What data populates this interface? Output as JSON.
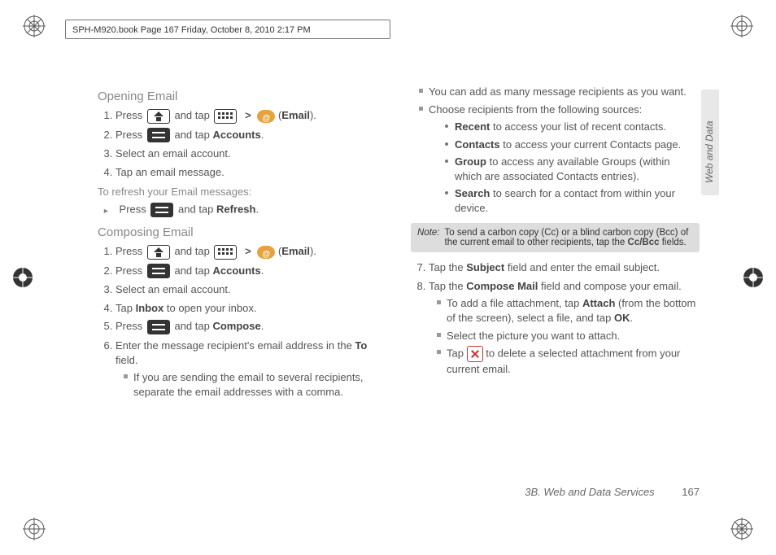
{
  "header": {
    "text": "SPH-M920.book  Page 167  Friday, October 8, 2010  2:17 PM"
  },
  "side_tab": {
    "label": "Web and Data"
  },
  "footer": {
    "section": "3B. Web and Data Services",
    "page": "167"
  },
  "labels": {
    "email": "Email",
    "accounts": "Accounts",
    "refresh": "Refresh",
    "inbox": "Inbox",
    "compose": "Compose",
    "to": "To",
    "recent": "Recent",
    "contacts": "Contacts",
    "group": "Group",
    "search": "Search",
    "subject": "Subject",
    "compose_mail": "Compose Mail",
    "attach": "Attach",
    "ok": "OK",
    "ccbcc": "Cc/Bcc",
    "gt": ">",
    "note": "Note:"
  },
  "headings": {
    "opening": "Opening Email",
    "refresh_sub": "To refresh your Email messages:",
    "composing": "Composing Email"
  },
  "left": {
    "open_s1a": "Press ",
    "open_s1b": " and tap ",
    "open_s1c": " (",
    "open_s1d": ").",
    "open_s2a": "Press ",
    "open_s2b": " and tap ",
    "open_s2c": ".",
    "open_s3": "Select an email account.",
    "open_s4": "Tap an email message.",
    "refresh_a": "Press ",
    "refresh_b": " and tap ",
    "refresh_c": ".",
    "comp_s1a": "Press ",
    "comp_s1b": " and tap ",
    "comp_s1c": " (",
    "comp_s1d": ").",
    "comp_s2a": "Press ",
    "comp_s2b": " and tap ",
    "comp_s2c": ".",
    "comp_s3": "Select an email account.",
    "comp_s4a": "Tap ",
    "comp_s4b": " to open your inbox.",
    "comp_s5a": "Press ",
    "comp_s5b": " and tap ",
    "comp_s5c": ".",
    "comp_s6a": "Enter the message recipient's email address in the ",
    "comp_s6b": " field.",
    "comp_s6_sub": "If you are sending the email to several recipients, separate the email addresses with a comma."
  },
  "right": {
    "r1": "You can add as many message recipients as you want.",
    "r2": "Choose recipients from the following sources:",
    "recent_txt": " to access your list of recent contacts.",
    "contacts_txt": " to access your current Contacts page.",
    "group_txt": " to access any available Groups (within which are associated Contacts entries).",
    "search_txt": " to search for a contact from within your device.",
    "note_body_a": "To send a carbon copy (Cc) or a blind carbon copy (Bcc) of the current email to other recipients, tap the ",
    "note_body_b": " fields.",
    "s7a": "Tap the ",
    "s7b": " field and enter the email subject.",
    "s8a": "Tap the ",
    "s8b": " field and compose your email.",
    "s8_sub1a": "To add a file attachment, tap ",
    "s8_sub1b": " (from the bottom of the screen), select a file, and tap ",
    "s8_sub1c": ".",
    "s8_sub2": "Select the picture you want to attach.",
    "s8_sub3a": "Tap ",
    "s8_sub3b": " to delete a selected attachment from your current email."
  }
}
